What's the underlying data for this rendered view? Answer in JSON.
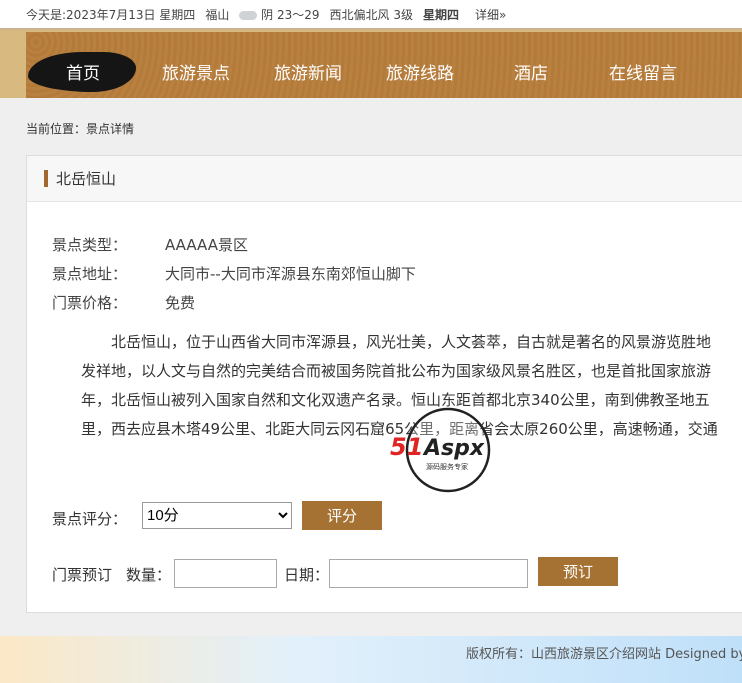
{
  "topbar": {
    "date": "今天是:2023年7月13日 星期四",
    "city": "福山",
    "weather": "阴 23～29",
    "wind": "西北偏北风 3级",
    "weekday": "星期四",
    "detail": "详细»"
  },
  "nav": [
    "首页",
    "旅游景点",
    "旅游新闻",
    "旅游线路",
    "酒店",
    "在线留言"
  ],
  "breadcrumb": "当前位置：景点详情",
  "title": "北岳恒山",
  "info": [
    {
      "label": "景点类型：",
      "value": "AAAAA景区"
    },
    {
      "label": "景点地址：",
      "value": "大同市--大同市浑源县东南郊恒山脚下"
    },
    {
      "label": "门票价格：",
      "value": "免费"
    }
  ],
  "paragraph": [
    "　　北岳恒山，位于山西省大同市浑源县，风光壮美，人文荟萃，自古就是著名的风景游览胜地",
    "发祥地，以人文与自然的完美结合而被国务院首批公布为国家级风景名胜区，也是首批国家旅游",
    "年，北岳恒山被列入国家自然和文化双遗产名录。恒山东距首都北京340公里，南到佛教圣地五",
    "里，西去应县木塔49公里、北距大同云冈石窟65公里，距离省会太原260公里，高速畅通，交通"
  ],
  "rating": {
    "label": "景点评分：",
    "selected": "10分",
    "button": "评分"
  },
  "booking": {
    "label": "门票预订",
    "qty_label": "数量：",
    "date_label": "日期：",
    "qty": "",
    "date": "",
    "button": "预订"
  },
  "watermark": {
    "brand": "51Aspx",
    "slogan": "源码服务专家"
  },
  "footer": "版权所有：山西旅游景区介绍网站 Designed by 管理"
}
